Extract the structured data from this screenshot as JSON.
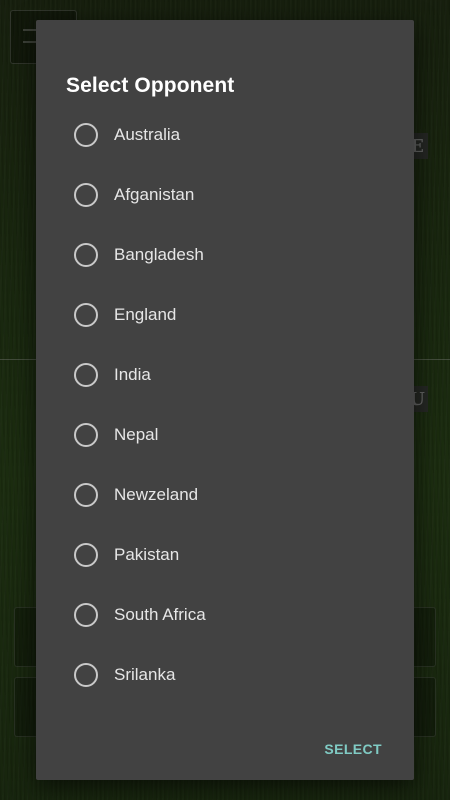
{
  "dialog": {
    "title": "Select Opponent",
    "options": [
      {
        "label": "Australia",
        "selected": false
      },
      {
        "label": "Afganistan",
        "selected": false
      },
      {
        "label": "Bangladesh",
        "selected": false
      },
      {
        "label": "England",
        "selected": false
      },
      {
        "label": "India",
        "selected": false
      },
      {
        "label": "Nepal",
        "selected": false
      },
      {
        "label": "Newzeland",
        "selected": false
      },
      {
        "label": "Pakistan",
        "selected": false
      },
      {
        "label": "South Africa",
        "selected": false
      },
      {
        "label": "Srilanka",
        "selected": false
      }
    ],
    "select_label": "SELECT"
  },
  "background": {
    "tag_top": "E",
    "tag_mid": "U"
  },
  "colors": {
    "dialog_bg": "#424242",
    "accent": "#80cbc4",
    "radio_border": "#c9c9c9"
  }
}
